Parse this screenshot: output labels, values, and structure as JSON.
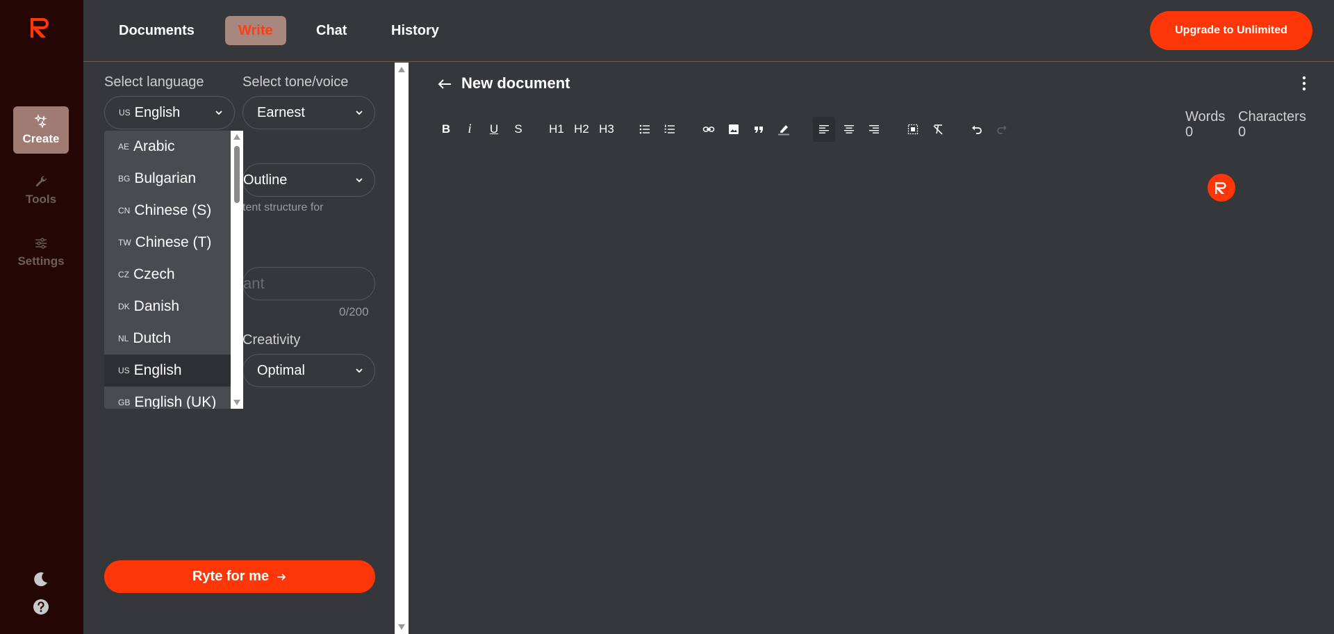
{
  "nav": {
    "tabs": [
      {
        "label": "Documents"
      },
      {
        "label": "Write"
      },
      {
        "label": "Chat"
      },
      {
        "label": "History"
      }
    ],
    "upgrade_label": "Upgrade to Unlimited"
  },
  "sidebar": {
    "items": [
      {
        "label": "Create",
        "icon": "sparkles-icon"
      },
      {
        "label": "Tools",
        "icon": "wrench-icon"
      },
      {
        "label": "Settings",
        "icon": "sliders-icon"
      }
    ]
  },
  "form": {
    "language_label": "Select language",
    "language_value": {
      "code": "US",
      "name": "English"
    },
    "tone_label": "Select tone/voice",
    "tone_value": "Earnest",
    "usecase_value": "Outline",
    "usecase_hint": "tent structure for",
    "input_ghost": "ant",
    "counter": "0/200",
    "creativity_label": "Creativity",
    "creativity_value": "Optimal",
    "submit_label": "Ryte for me"
  },
  "language_dropdown": {
    "options": [
      {
        "code": "AE",
        "name": "Arabic"
      },
      {
        "code": "BG",
        "name": "Bulgarian"
      },
      {
        "code": "CN",
        "name": "Chinese (S)"
      },
      {
        "code": "TW",
        "name": "Chinese (T)"
      },
      {
        "code": "CZ",
        "name": "Czech"
      },
      {
        "code": "DK",
        "name": "Danish"
      },
      {
        "code": "NL",
        "name": "Dutch"
      },
      {
        "code": "US",
        "name": "English"
      },
      {
        "code": "GB",
        "name": "English (UK)"
      }
    ],
    "selected": "English"
  },
  "editor": {
    "title": "New document",
    "toolbar": {
      "bold": "B",
      "italic": "i",
      "underline": "U",
      "strike": "S",
      "h1": "H1",
      "h2": "H2",
      "h3": "H3"
    },
    "words_label": "Words",
    "words_value": "0",
    "chars_label": "Characters",
    "chars_value": "0"
  },
  "colors": {
    "accent": "#ff3607",
    "rail": "#240604",
    "background": "#36373b"
  }
}
